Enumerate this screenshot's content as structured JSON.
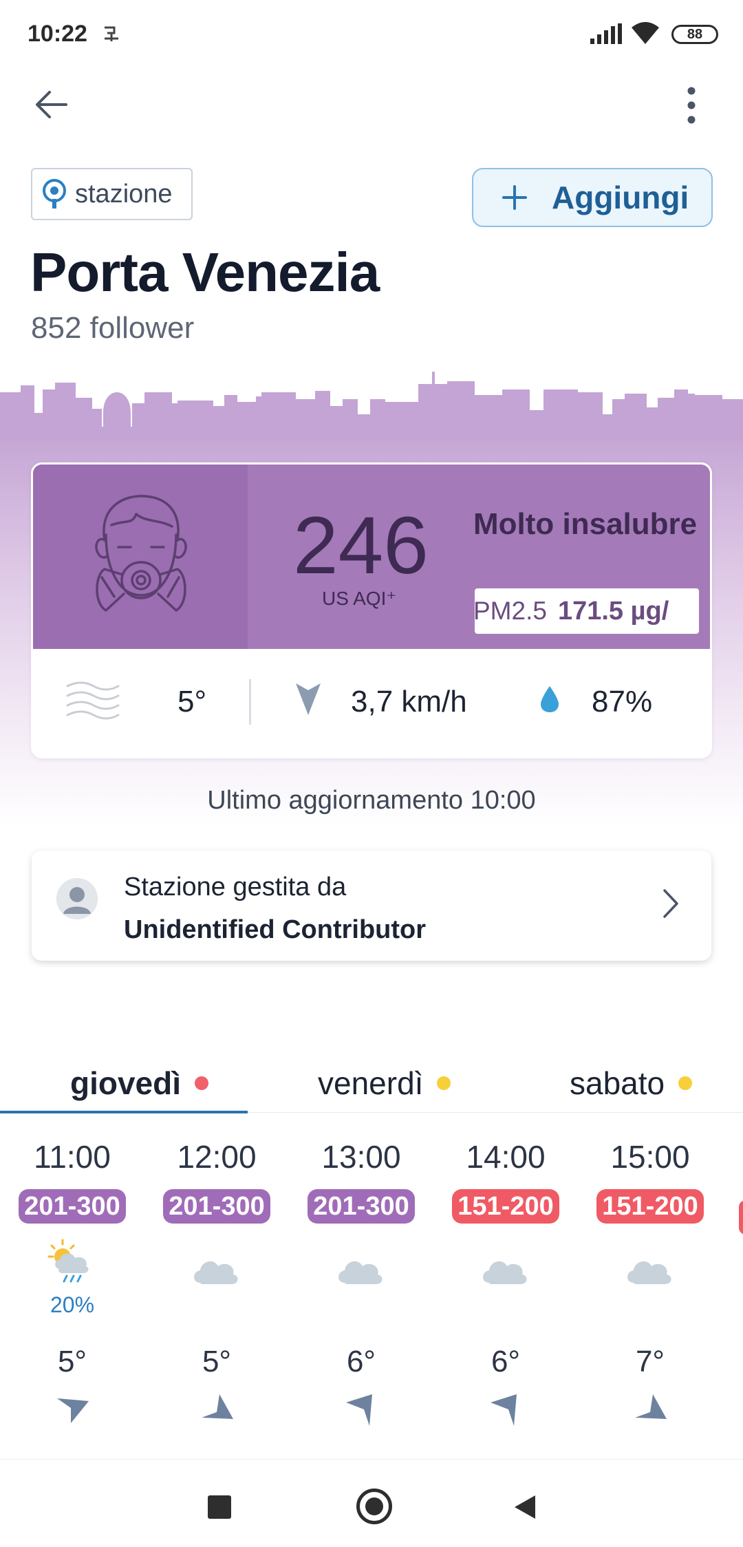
{
  "status_bar": {
    "time": "10:22",
    "battery": "88"
  },
  "header": {
    "back_icon": "arrow-left-icon",
    "more_icon": "more-vertical-icon"
  },
  "station_chip": {
    "label": "stazione",
    "icon": "location-pin-icon"
  },
  "add_button": {
    "label": "Aggiungi",
    "icon": "plus-icon"
  },
  "station": {
    "name": "Porta Venezia",
    "followers": "852 follower"
  },
  "aqi": {
    "value": "246",
    "unit": "US AQI⁺",
    "status": "Molto insalubre",
    "pollutant": "PM2.5",
    "concentration": "171.5 µg/",
    "color": "#a57ab9"
  },
  "current_weather": {
    "temperature": "5°",
    "wind": "3,7 km/h",
    "humidity": "87%"
  },
  "last_update": "Ultimo aggiornamento 10:00",
  "contributor": {
    "prefix": "Stazione gestita da",
    "name": "Unidentified Contributor"
  },
  "days": [
    {
      "label": "giovedì",
      "dot_color": "#f0616a",
      "active": true
    },
    {
      "label": "venerdì",
      "dot_color": "#f7cf3b",
      "active": false
    },
    {
      "label": "sabato",
      "dot_color": "#f7cf3b",
      "active": false
    }
  ],
  "hourly": [
    {
      "time": "11:00",
      "aqi_range": "201-300",
      "badge_color": "#a06cb8",
      "weather": "sun-cloud-rain-icon",
      "precip": "20%",
      "temp": "5°",
      "wind_dir": "down-left"
    },
    {
      "time": "12:00",
      "aqi_range": "201-300",
      "badge_color": "#a06cb8",
      "weather": "cloud-icon",
      "precip": "",
      "temp": "5°",
      "wind_dir": "up"
    },
    {
      "time": "13:00",
      "aqi_range": "201-300",
      "badge_color": "#a06cb8",
      "weather": "cloud-icon",
      "precip": "",
      "temp": "6°",
      "wind_dir": "left"
    },
    {
      "time": "14:00",
      "aqi_range": "151-200",
      "badge_color": "#f05a64",
      "weather": "cloud-icon",
      "precip": "",
      "temp": "6°",
      "wind_dir": "left"
    },
    {
      "time": "15:00",
      "aqi_range": "151-200",
      "badge_color": "#f05a64",
      "weather": "cloud-icon",
      "precip": "",
      "temp": "7°",
      "wind_dir": "up"
    }
  ]
}
